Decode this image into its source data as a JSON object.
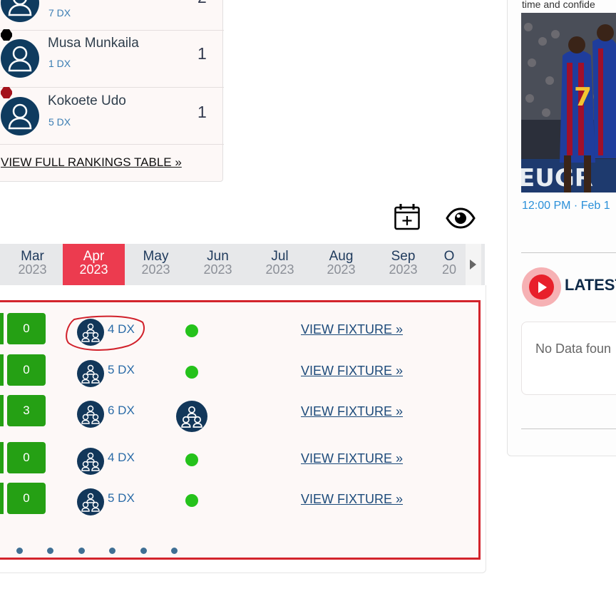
{
  "rankings": {
    "rows": [
      {
        "name": "",
        "sub": "7 DX",
        "score": "2"
      },
      {
        "name": "Musa Munkaila",
        "sub": "1 DX",
        "score": "1"
      },
      {
        "name": "Kokoete Udo",
        "sub": "5 DX",
        "score": "1"
      }
    ],
    "view_full": "VIEW FULL RANKINGS TABLE »"
  },
  "toolbar": {
    "calendar_icon": "calendar-plus-icon",
    "eye_icon": "eye-icon"
  },
  "months": [
    {
      "m": "Mar",
      "y": "2023"
    },
    {
      "m": "Apr",
      "y": "2023",
      "active": true
    },
    {
      "m": "May",
      "y": "2023"
    },
    {
      "m": "Jun",
      "y": "2023"
    },
    {
      "m": "Jul",
      "y": "2023"
    },
    {
      "m": "Aug",
      "y": "2023"
    },
    {
      "m": "Sep",
      "y": "2023"
    },
    {
      "m": "O",
      "y": "20"
    }
  ],
  "fixtures": [
    {
      "score": "0",
      "dx": "4 DX",
      "status": "dot",
      "link": "VIEW FIXTURE »"
    },
    {
      "score": "0",
      "dx": "5 DX",
      "status": "dot",
      "link": "VIEW FIXTURE »"
    },
    {
      "score": "3",
      "dx": "6 DX",
      "status": "team",
      "link": "VIEW FIXTURE »"
    },
    {
      "score": "0",
      "dx": "4 DX",
      "status": "dot",
      "link": "VIEW FIXTURE »"
    },
    {
      "score": "0",
      "dx": "5 DX",
      "status": "dot",
      "link": "VIEW FIXTURE »"
    }
  ],
  "colors": {
    "accent_red": "#ec3b4f",
    "score_green": "#25a014",
    "status_green": "#25c21b",
    "navy": "#12375a"
  },
  "sidebar": {
    "top_text": "time and confide",
    "timestamp": "12:00 PM · Feb 1",
    "latest_title": "LATEST",
    "no_data": "No Data foun"
  }
}
